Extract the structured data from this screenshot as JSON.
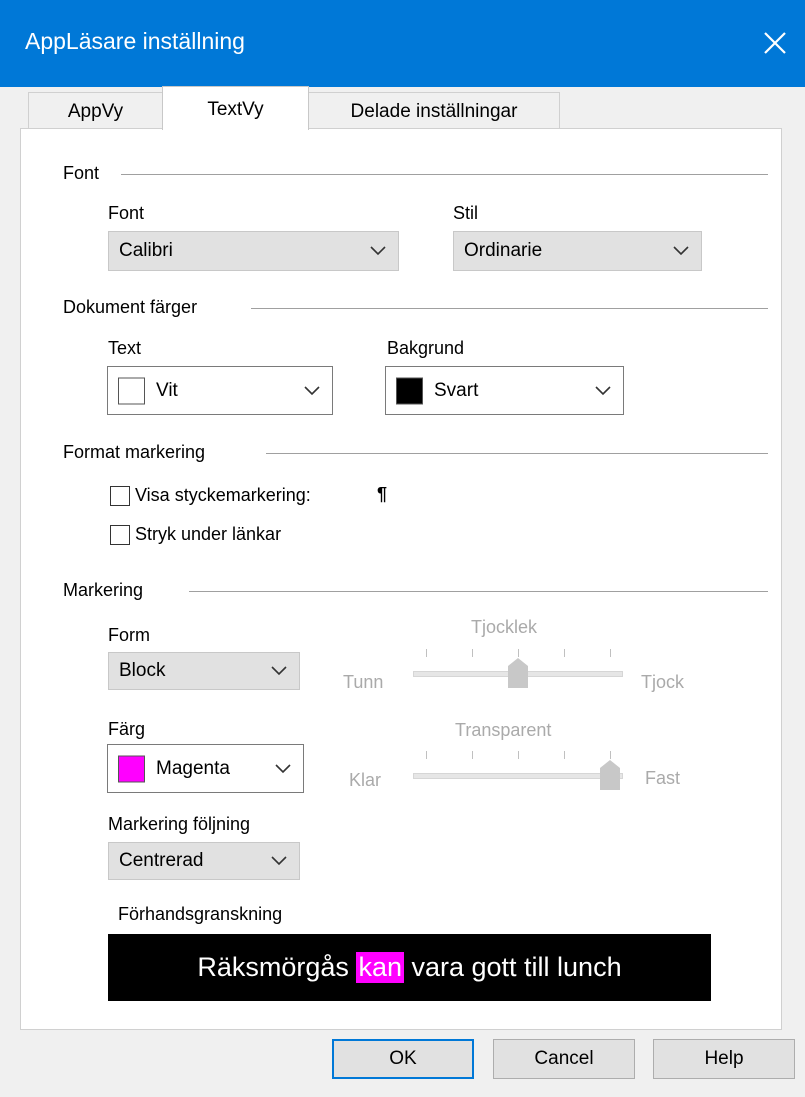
{
  "window": {
    "title": "AppLäsare inställning"
  },
  "tabs": [
    {
      "label": "AppVy",
      "active": false
    },
    {
      "label": "TextVy",
      "active": true
    },
    {
      "label": "Delade inställningar",
      "active": false
    }
  ],
  "font_section": {
    "title": "Font",
    "font_label": "Font",
    "font_value": "Calibri",
    "style_label": "Stil",
    "style_value": "Ordinarie"
  },
  "colors_section": {
    "title": "Dokument färger",
    "text_label": "Text",
    "text_value": "Vit",
    "text_swatch": "#ffffff",
    "background_label": "Bakgrund",
    "background_value": "Svart",
    "background_swatch": "#000000"
  },
  "format_section": {
    "title": "Format markering",
    "show_paragraph_label": "Visa styckemarkering:",
    "show_paragraph_checked": false,
    "paragraph_symbol": "¶",
    "underline_links_label": "Stryk under länkar",
    "underline_links_checked": false
  },
  "marking_section": {
    "title": "Markering",
    "form_label": "Form",
    "form_value": "Block",
    "thickness_title": "Tjocklek",
    "thickness_min_label": "Tunn",
    "thickness_max_label": "Tjock",
    "thickness_level": 0.5,
    "color_label": "Färg",
    "color_value": "Magenta",
    "color_swatch": "#ff00ff",
    "transparency_title": "Transparent",
    "transparency_min_label": "Klar",
    "transparency_max_label": "Fast",
    "transparency_level": 1.0,
    "follow_label": "Markering följning",
    "follow_value": "Centrerad"
  },
  "preview": {
    "label": "Förhandsgranskning",
    "text_before": "Räksmörgås ",
    "highlighted_word": "kan",
    "text_after": " vara gott till lunch",
    "background": "#000000",
    "text_color": "#ffffff",
    "highlight_color": "#ff00ff"
  },
  "buttons": {
    "ok": "OK",
    "cancel": "Cancel",
    "help": "Help"
  },
  "colors": {
    "titlebar": "#0078d7",
    "default_button_border": "#0078d7"
  }
}
